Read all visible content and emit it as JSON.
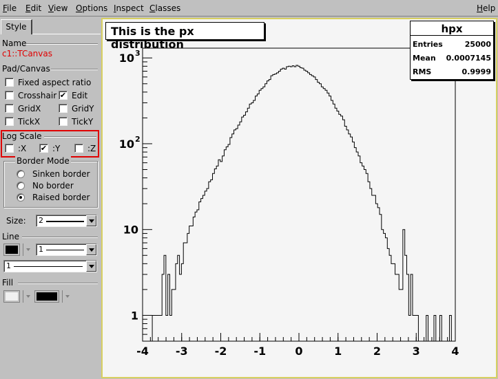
{
  "menu": {
    "file": {
      "ul": "F",
      "rest": "ile"
    },
    "edit": {
      "ul": "E",
      "rest": "dit"
    },
    "view": {
      "ul": "V",
      "rest": "iew"
    },
    "options": {
      "ul": "O",
      "rest": "ptions"
    },
    "inspect": {
      "ul": "I",
      "rest": "nspect"
    },
    "classes": {
      "ul": "C",
      "rest": "lasses"
    },
    "help": {
      "ul": "H",
      "rest": "elp"
    }
  },
  "panel": {
    "tab_label": "Style",
    "name_label": "Name",
    "object_name": "c1::TCanvas",
    "pad_canvas_label": "Pad/Canvas",
    "fixed_aspect": "Fixed aspect ratio",
    "crosshair": "Crosshair",
    "edit": "Edit",
    "edit_check": "✔",
    "gridx": "GridX",
    "gridy": "GridY",
    "tickx": "TickX",
    "ticky": "TickY",
    "log_scale_label": "Log Scale",
    "log_x": ":X",
    "log_y": ":Y",
    "log_y_check": "✔",
    "log_z": ":Z",
    "border_mode_label": "Border Mode",
    "sinken": "Sinken border",
    "no_border": "No border",
    "raised": "Raised border",
    "size_label": "Size:",
    "size_value": "2",
    "line_label": "Line",
    "line_width_value": "1",
    "line_style_value": "1",
    "fill_label": "Fill",
    "line_color": "#000000",
    "fill_color": "#f0f0f0",
    "fill_pattern_color": "#000000"
  },
  "histogram": {
    "title": "This is the px distribution",
    "stats": {
      "name": "hpx",
      "entries_label": "Entries",
      "entries_value": "25000",
      "mean_label": "Mean",
      "mean_value": "0.0007145",
      "rms_label": "RMS",
      "rms_value": "0.9999"
    }
  },
  "chart_data": {
    "type": "histogram",
    "title": "This is the px distribution",
    "x_range": [
      -4,
      4
    ],
    "y_scale": "log",
    "y_range": [
      0.5,
      1300
    ],
    "x_ticks": [
      "-4",
      "-3",
      "-2",
      "-1",
      "0",
      "1",
      "2",
      "3",
      "4"
    ],
    "y_ticks": [
      {
        "label": "1",
        "value": 1
      },
      {
        "label": "10",
        "value": 10
      },
      {
        "label": "10",
        "sup": "2",
        "value": 100
      },
      {
        "label": "10",
        "sup": "3",
        "value": 1000
      }
    ],
    "bins": [
      -4.0,
      3.96
    ],
    "counts": [
      0,
      0,
      0,
      0,
      0,
      1,
      1,
      1,
      1,
      1,
      3,
      5,
      1,
      3,
      1,
      2,
      2,
      4,
      5,
      3,
      4,
      7,
      7,
      9,
      11,
      11,
      14,
      16,
      17,
      21,
      23,
      25,
      28,
      30,
      36,
      38,
      45,
      51,
      55,
      65,
      62,
      72,
      85,
      92,
      98,
      118,
      130,
      145,
      150,
      165,
      180,
      205,
      215,
      235,
      260,
      290,
      300,
      320,
      360,
      380,
      420,
      440,
      460,
      500,
      540,
      560,
      620,
      640,
      650,
      670,
      700,
      740,
      760,
      740,
      790,
      800,
      790,
      810,
      790,
      820,
      800,
      770,
      760,
      720,
      700,
      670,
      640,
      620,
      600,
      560,
      520,
      500,
      460,
      440,
      420,
      390,
      360,
      320,
      290,
      260,
      240,
      220,
      210,
      190,
      160,
      145,
      130,
      120,
      105,
      90,
      80,
      72,
      60,
      55,
      50,
      45,
      36,
      30,
      25,
      25,
      20,
      18,
      15,
      10,
      9,
      8,
      6,
      5,
      4,
      4,
      3,
      3,
      2,
      2,
      10,
      5,
      3,
      1,
      3,
      1,
      1,
      1,
      0,
      0,
      0,
      0,
      1,
      0,
      0,
      0,
      1,
      0,
      0,
      1,
      0,
      0,
      0,
      0,
      1,
      0,
      0
    ]
  }
}
